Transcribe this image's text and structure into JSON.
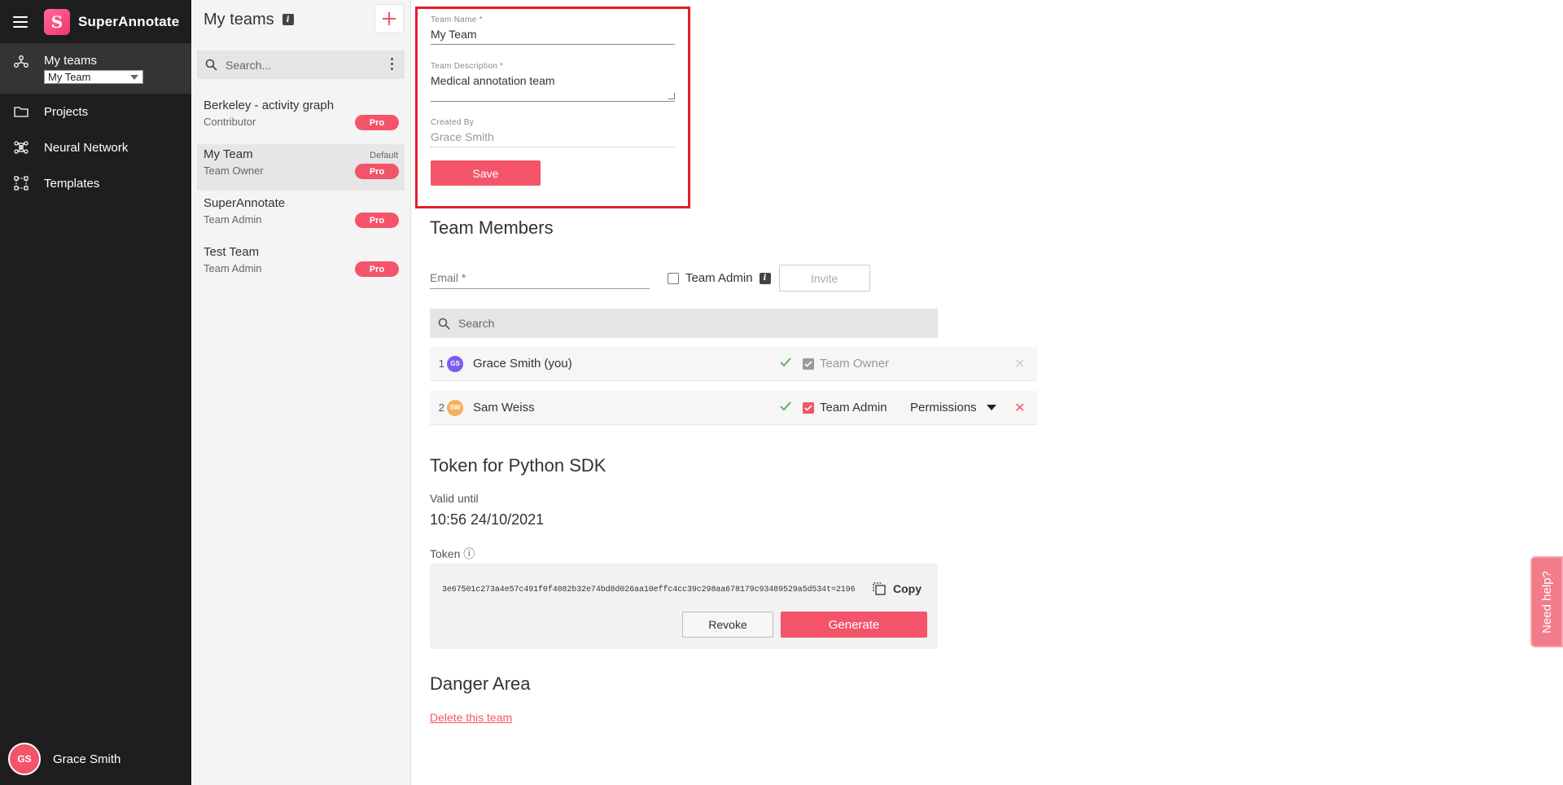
{
  "app": {
    "brand": "SuperAnnotate",
    "logo_letter": "S"
  },
  "nav": {
    "items": [
      {
        "label": "My teams",
        "icon": "teams-icon",
        "active": true,
        "selected_team": "My Team"
      },
      {
        "label": "Projects",
        "icon": "folder-icon"
      },
      {
        "label": "Neural Network",
        "icon": "neural-network-icon"
      },
      {
        "label": "Templates",
        "icon": "templates-icon"
      }
    ],
    "user": {
      "initials": "GS",
      "name": "Grace Smith"
    }
  },
  "teams_panel": {
    "title": "My teams",
    "info": "i",
    "add": "+",
    "search_placeholder": "Search...",
    "teams": [
      {
        "name": "Berkeley - activity graph",
        "role": "Contributor",
        "badge": "Pro",
        "tag": ""
      },
      {
        "name": "My Team",
        "role": "Team Owner",
        "badge": "Pro",
        "tag": "Default"
      },
      {
        "name": "SuperAnnotate",
        "role": "Team Admin",
        "badge": "Pro",
        "tag": ""
      },
      {
        "name": "Test Team",
        "role": "Team Admin",
        "badge": "Pro",
        "tag": ""
      }
    ]
  },
  "form": {
    "team_name_label": "Team Name *",
    "team_name_value": "My Team",
    "team_desc_label": "Team Description *",
    "team_desc_value": "Medical annotation team",
    "created_by_label": "Created By",
    "created_by_value": "Grace Smith",
    "save_label": "Save"
  },
  "members": {
    "title": "Team Members",
    "email_placeholder": "Email *",
    "team_admin_label": "Team Admin",
    "info": "i",
    "invite_label": "Invite",
    "search_placeholder": "Search",
    "rows": [
      {
        "index": "1",
        "initials": "GS",
        "name": "Grace Smith (you)",
        "role": "Team Owner",
        "permissions": "",
        "avatar_color": "#7d5cf0"
      },
      {
        "index": "2",
        "initials": "SW",
        "name": "Sam Weiss",
        "role": "Team Admin",
        "permissions": "Permissions",
        "avatar_color": "#f5b25c"
      }
    ]
  },
  "token": {
    "title": "Token for Python SDK",
    "valid_label": "Valid until",
    "valid_value": "10:56 24/10/2021",
    "token_label": "Token ⓘ",
    "token_value": "3e67501c273a4e57c491f0f4082b32e74bd8d026aa10effc4cc39c298aa678179c93489529a5d534t=2196",
    "copy_label": "Copy",
    "revoke_label": "Revoke",
    "generate_label": "Generate"
  },
  "danger": {
    "title": "Danger Area",
    "delete_label": "Delete this team"
  },
  "help": {
    "label": "Need help?"
  },
  "colors": {
    "accent": "#f3546a",
    "nav_bg": "#1e1e1e",
    "highlight_border": "#e31e2a"
  }
}
